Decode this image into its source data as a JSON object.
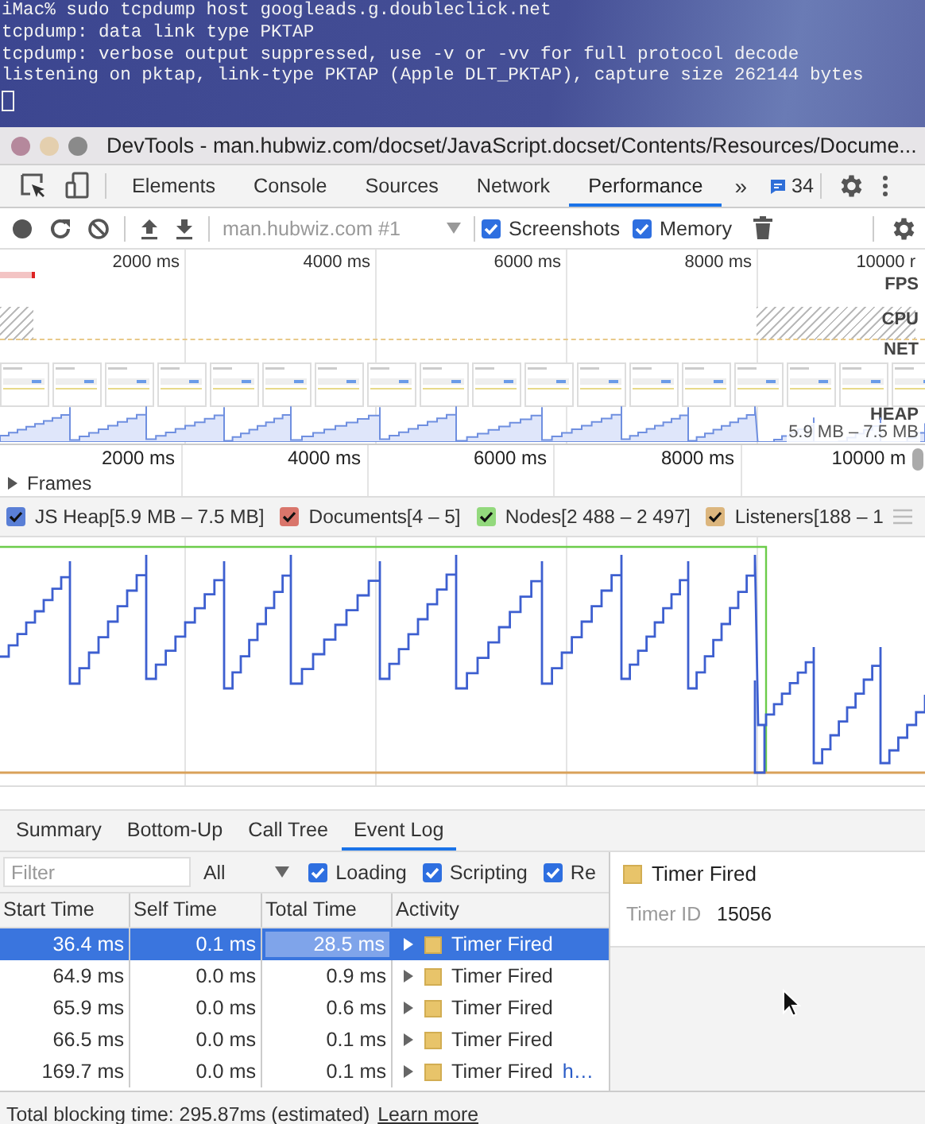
{
  "terminal": {
    "lines": [
      "iMac% sudo tcpdump host googleads.g.doubleclick.net",
      "tcpdump: data link type PKTAP",
      "tcpdump: verbose output suppressed, use -v or -vv for full protocol decode",
      "listening on pktap, link-type PKTAP (Apple DLT_PKTAP), capture size 262144 bytes"
    ]
  },
  "window": {
    "title": "DevTools - man.hubwiz.com/docset/JavaScript.docset/Contents/Resources/Docume..."
  },
  "tabs": [
    {
      "label": "Elements",
      "selected": false
    },
    {
      "label": "Console",
      "selected": false
    },
    {
      "label": "Sources",
      "selected": false
    },
    {
      "label": "Network",
      "selected": false
    },
    {
      "label": "Performance",
      "selected": true
    }
  ],
  "more_tabs": "»",
  "messages_count": "34",
  "toolbar": {
    "target": "man.hubwiz.com #1",
    "options": [
      {
        "label": "Screenshots",
        "checked": true
      },
      {
        "label": "Memory",
        "checked": true
      }
    ]
  },
  "overview": {
    "ticks": [
      "2000 ms",
      "4000 ms",
      "6000 ms",
      "8000 ms",
      "10000 r"
    ],
    "tracks": [
      "FPS",
      "CPU",
      "NET",
      "HEAP"
    ],
    "heap_range": "5.9 MB – 7.5 MB"
  },
  "ruler": {
    "ticks": [
      "2000 ms",
      "4000 ms",
      "6000 ms",
      "8000 ms",
      "10000 m"
    ]
  },
  "frames": {
    "label": "Frames",
    "expanded": false
  },
  "counters": [
    {
      "label": "JS Heap[5.9 MB – 7.5 MB]",
      "checked": true,
      "color": "#5a7fd6"
    },
    {
      "label": "Documents[4 – 5]",
      "checked": true,
      "color": "#d9756b"
    },
    {
      "label": "Nodes[2 488 – 2 497]",
      "checked": true,
      "color": "#93d97d"
    },
    {
      "label": "Listeners[188 – 1",
      "checked": true,
      "color": "#dcb67e"
    }
  ],
  "bottom_tabs": [
    {
      "label": "Summary",
      "selected": false
    },
    {
      "label": "Bottom-Up",
      "selected": false
    },
    {
      "label": "Call Tree",
      "selected": false
    },
    {
      "label": "Event Log",
      "selected": true
    }
  ],
  "filter": {
    "placeholder": "Filter",
    "level": "All",
    "categories": [
      {
        "label": "Loading",
        "checked": true
      },
      {
        "label": "Scripting",
        "checked": true
      },
      {
        "label": "Re",
        "checked": true
      }
    ]
  },
  "table": {
    "columns": [
      "Start Time",
      "Self Time",
      "Total Time",
      "Activity"
    ],
    "rows": [
      {
        "start": "36.4 ms",
        "self": "0.1 ms",
        "total": "28.5 ms",
        "activity": "Timer Fired",
        "selected": true
      },
      {
        "start": "64.9 ms",
        "self": "0.0 ms",
        "total": "0.9 ms",
        "activity": "Timer Fired",
        "selected": false
      },
      {
        "start": "65.9 ms",
        "self": "0.0 ms",
        "total": "0.6 ms",
        "activity": "Timer Fired",
        "selected": false
      },
      {
        "start": "66.5 ms",
        "self": "0.0 ms",
        "total": "0.1 ms",
        "activity": "Timer Fired",
        "selected": false
      },
      {
        "start": "169.7 ms",
        "self": "0.0 ms",
        "total": "0.1 ms",
        "activity": "Timer Fired",
        "link": "h…",
        "selected": false
      }
    ]
  },
  "details": {
    "title": "Timer Fired",
    "fields": [
      {
        "label": "Timer ID",
        "value": "15056"
      }
    ]
  },
  "footer": {
    "text": "Total blocking time: 295.87ms (estimated)",
    "link": "Learn more"
  }
}
